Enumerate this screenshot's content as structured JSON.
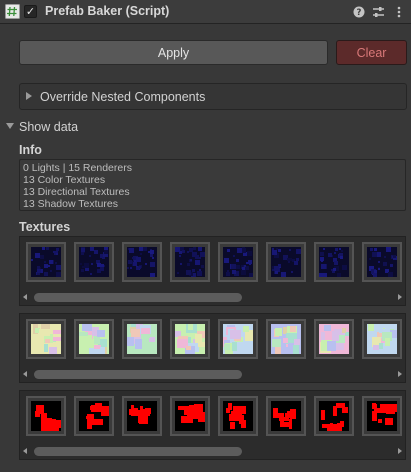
{
  "header": {
    "title": "Prefab Baker (Script)",
    "enabled": true,
    "icons": [
      "script-icon",
      "help-icon",
      "presets-icon",
      "more-vert-icon"
    ]
  },
  "buttons": {
    "apply_label": "Apply",
    "clear_label": "Clear"
  },
  "foldouts": {
    "override_label": "Override Nested Components",
    "show_data_label": "Show data"
  },
  "info": {
    "title": "Info",
    "lines": {
      "lights_renderers": "0 Lights |  15 Renderers",
      "color": "13 Color Textures",
      "directional": "13 Directional Textures",
      "shadow": "13 Shadow Textures"
    }
  },
  "textures": {
    "title": "Textures",
    "strips": [
      {
        "kind": "directional",
        "count": 8,
        "scroll_fraction": 0.58
      },
      {
        "kind": "color",
        "count": 8,
        "scroll_fraction": 0.58
      },
      {
        "kind": "shadow",
        "count": 8,
        "scroll_fraction": 0.58
      }
    ]
  },
  "colors": {
    "background": "#383838",
    "clear_button": "#5c2a2a",
    "clear_text": "#d87878",
    "shadow_red": "#ff0000",
    "directional_blue": "#1a1a5a"
  }
}
